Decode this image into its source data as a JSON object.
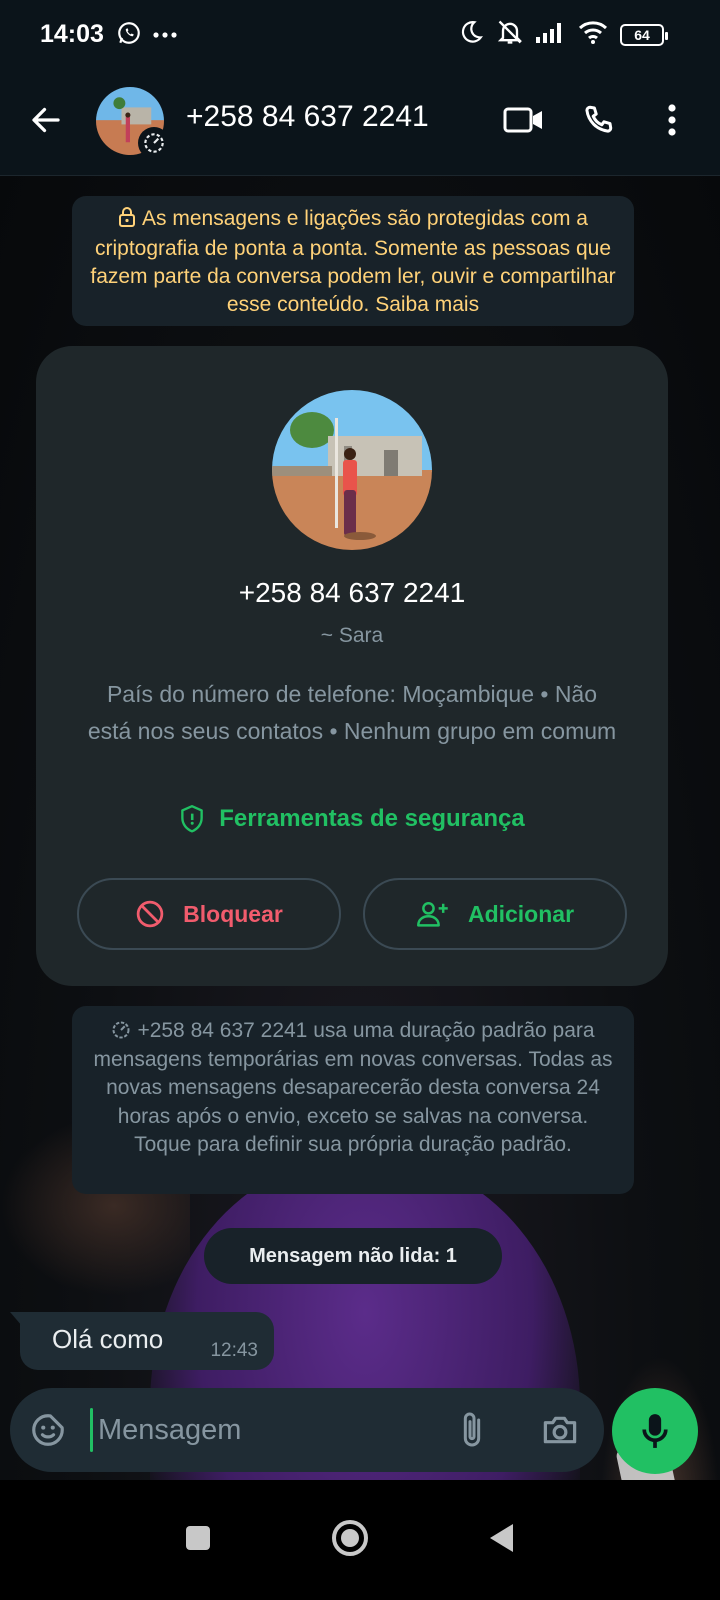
{
  "status_bar": {
    "time": "14:03",
    "battery": "64",
    "icons": [
      "whatsapp-icon",
      "more-dots-icon",
      "moon-icon",
      "bell-off-icon",
      "signal-icon",
      "wifi-icon",
      "battery-icon"
    ]
  },
  "header": {
    "title": "+258 84 637 2241",
    "icons": [
      "back-arrow-icon",
      "video-call-icon",
      "voice-call-icon",
      "more-vert-icon",
      "timer-icon"
    ]
  },
  "encryption_notice": {
    "text": "As mensagens e ligações são protegidas com a criptografia de ponta a ponta. Somente as pessoas que fazem parte da conversa podem ler, ouvir e compartilhar esse conteúdo. Saiba mais"
  },
  "profile_card": {
    "phone": "+258 84 637 2241",
    "alias": "~ Sara",
    "info": "País do número de telefone: Moçambique • Não está nos seus contatos • Nenhum grupo em comum",
    "security_tools": "Ferramentas de segurança",
    "block_label": "Bloquear",
    "add_label": "Adicionar"
  },
  "disappearing_notice": {
    "text": "+258 84 637 2241 usa uma duração padrão para mensagens temporárias em novas conversas. Todas as novas mensagens desaparecerão desta conversa 24 horas após o envio, exceto se salvas na conversa. Toque para definir sua própria duração padrão."
  },
  "unread_pill": "Mensagem não lida: 1",
  "messages": [
    {
      "text": "Olá como",
      "time": "12:43",
      "direction": "incoming"
    }
  ],
  "composer": {
    "placeholder": "Mensagem"
  },
  "colors": {
    "background": "#0b141a",
    "accent_green": "#21c063",
    "danger_red": "#f15c6d",
    "notice_yellow": "#ffd279",
    "bubble": "#1f2c34",
    "card": "#1f272a"
  }
}
